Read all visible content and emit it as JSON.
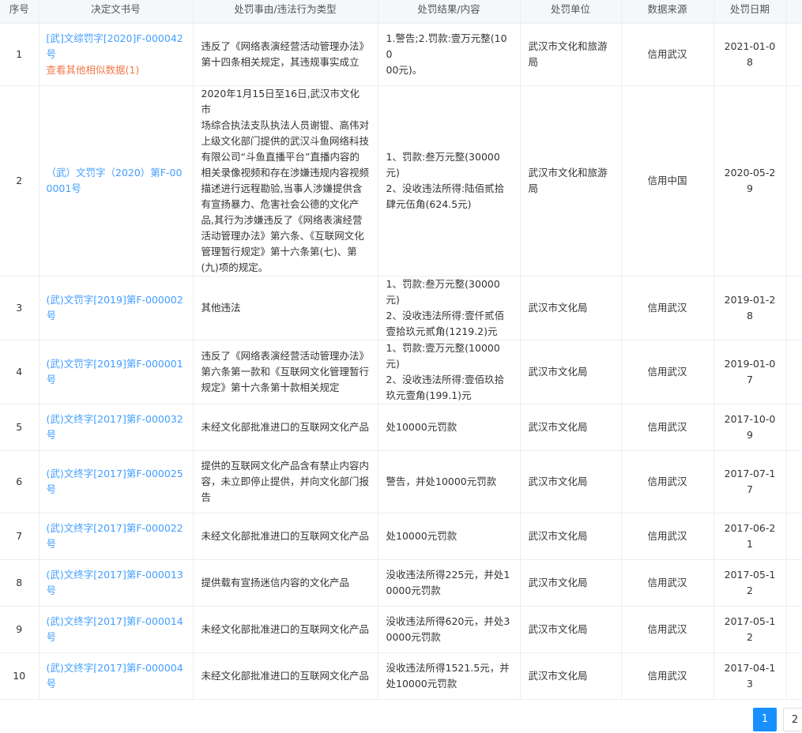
{
  "table": {
    "headers": [
      "序号",
      "决定文书号",
      "处罚事由/违法行为类型",
      "处罚结果/内容",
      "处罚单位",
      "数据来源",
      "处罚日期"
    ],
    "rows": [
      {
        "index": "1",
        "doc": [
          "[武]文综罚字[2020]F-000042",
          "号"
        ],
        "similar": "查看其他相似数据(1)",
        "reason": [
          "违反了《网络表演经营活动管理办法》",
          "第十四条相关规定，其违规事实成立"
        ],
        "result": [
          "1.警告;2.罚款:壹万元整(100",
          "00元)。"
        ],
        "unit": [
          "武汉市文化和旅游",
          "局"
        ],
        "source": "信用武汉",
        "date": "2021-01-08"
      },
      {
        "index": "2",
        "doc": [
          "（武）文罚字（2020）第F-00",
          "0001号"
        ],
        "reason": [
          "2020年1月15日至16日,武汉市文化市",
          "场综合执法支队执法人员谢锟、高伟对",
          "上级文化部门提供的武汉斗鱼网络科技",
          "有限公司“斗鱼直播平台”直播内容的",
          "相关录像视频和存在涉嫌违规内容视频",
          "描述进行远程勘验,当事人涉嫌提供含",
          "有宣扬暴力、危害社会公德的文化产",
          "品,其行为涉嫌违反了《网络表演经营",
          "活动管理办法》第六条、《互联网文化",
          "管理暂行规定》第十六条第(七)、第",
          "(九)项的规定。"
        ],
        "result": [
          "1、罚款:叁万元整(30000元)",
          "2、没收违法所得:陆佰贰拾",
          "肆元伍角(624.5元)"
        ],
        "unit": [
          "武汉市文化和旅游",
          "局"
        ],
        "source": "信用中国",
        "date": "2020-05-29"
      },
      {
        "index": "3",
        "doc": [
          "(武)文罚字[2019]第F-000002",
          "号"
        ],
        "reason": [
          "其他违法"
        ],
        "result": [
          "1、罚款:叁万元整(30000元)",
          "2、没收违法所得:壹仟贰佰",
          "壹拾玖元贰角(1219.2)元"
        ],
        "unit": [
          "武汉市文化局"
        ],
        "source": "信用武汉",
        "date": "2019-01-28"
      },
      {
        "index": "4",
        "doc": [
          "(武)文罚字[2019]第F-000001",
          "号"
        ],
        "reason": [
          "违反了《网络表演经营活动管理办法》",
          "第六条第一款和《互联网文化管理暂行",
          "规定》第十六条第十款相关规定"
        ],
        "result": [
          "1、罚款:壹万元整(10000元)",
          "2、没收违法所得:壹佰玖拾",
          "玖元壹角(199.1)元"
        ],
        "unit": [
          "武汉市文化局"
        ],
        "source": "信用武汉",
        "date": "2019-01-07"
      },
      {
        "index": "5",
        "doc": [
          "(武)文终字[2017]第F-000032",
          "号"
        ],
        "reason": [
          "未经文化部批准进口的互联网文化产品"
        ],
        "result": [
          "处10000元罚款"
        ],
        "unit": [
          "武汉市文化局"
        ],
        "source": "信用武汉",
        "date": "2017-10-09"
      },
      {
        "index": "6",
        "doc": [
          "(武)文终字[2017]第F-000025",
          "号"
        ],
        "reason": [
          "提供的互联网文化产品含有禁止内容内",
          "容，未立即停止提供，并向文化部门报",
          "告"
        ],
        "result": [
          "警告，并处10000元罚款"
        ],
        "unit": [
          "武汉市文化局"
        ],
        "source": "信用武汉",
        "date": "2017-07-17"
      },
      {
        "index": "7",
        "doc": [
          "(武)文终字[2017]第F-000022",
          "号"
        ],
        "reason": [
          "未经文化部批准进口的互联网文化产品"
        ],
        "result": [
          "处10000元罚款"
        ],
        "unit": [
          "武汉市文化局"
        ],
        "source": "信用武汉",
        "date": "2017-06-21"
      },
      {
        "index": "8",
        "doc": [
          "(武)文终字[2017]第F-000013",
          "号"
        ],
        "reason": [
          "提供载有宣扬迷信内容的文化产品"
        ],
        "result": [
          "没收违法所得225元，并处1",
          "0000元罚款"
        ],
        "unit": [
          "武汉市文化局"
        ],
        "source": "信用武汉",
        "date": "2017-05-12"
      },
      {
        "index": "9",
        "doc": [
          "(武)文终字[2017]第F-000014",
          "号"
        ],
        "reason": [
          "未经文化部批准进口的互联网文化产品"
        ],
        "result": [
          "没收违法所得620元，并处3",
          "0000元罚款"
        ],
        "unit": [
          "武汉市文化局"
        ],
        "source": "信用武汉",
        "date": "2017-05-12"
      },
      {
        "index": "10",
        "doc": [
          "(武)文终字[2017]第F-000004",
          "号"
        ],
        "reason": [
          "未经文化部批准进口的互联网文化产品"
        ],
        "result": [
          "没收违法所得1521.5元，并",
          "处10000元罚款"
        ],
        "unit": [
          "武汉市文化局"
        ],
        "source": "信用武汉",
        "date": "2017-04-13"
      }
    ]
  },
  "pagination": {
    "pages": [
      "1",
      "2"
    ],
    "current": "1"
  }
}
